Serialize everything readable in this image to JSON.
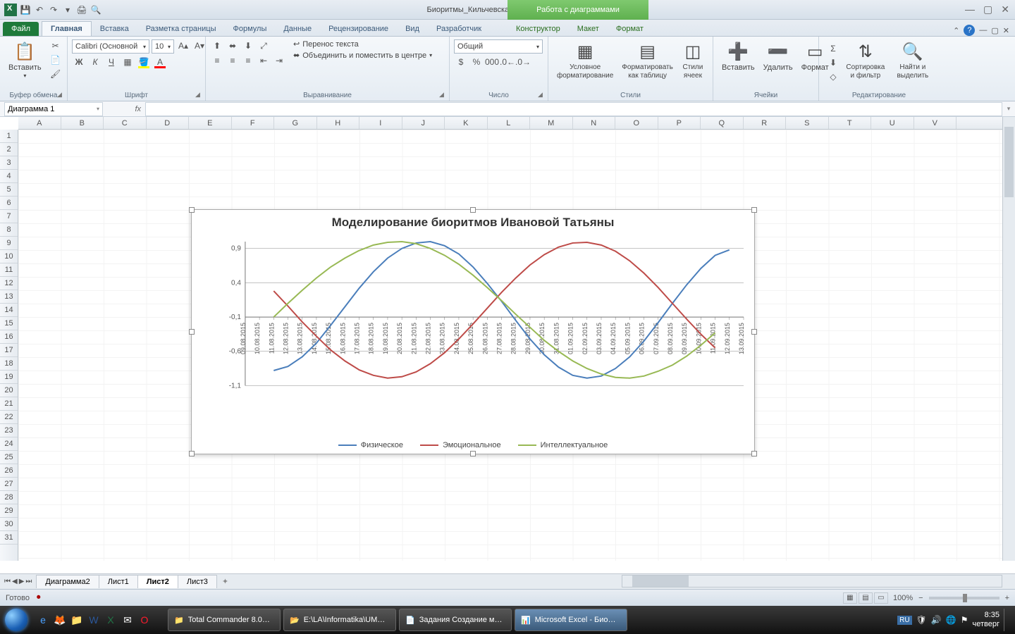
{
  "titlebar": {
    "document": "Биоритмы_Кильчевская.xlsx - Microsoft Excel",
    "chart_tools": "Работа с диаграммами"
  },
  "tabs": {
    "file": "Файл",
    "items": [
      "Главная",
      "Вставка",
      "Разметка страницы",
      "Формулы",
      "Данные",
      "Рецензирование",
      "Вид",
      "Разработчик"
    ],
    "chart_tabs": [
      "Конструктор",
      "Макет",
      "Формат"
    ],
    "active": "Главная"
  },
  "ribbon": {
    "clipboard": {
      "label": "Буфер обмена",
      "paste": "Вставить"
    },
    "font": {
      "label": "Шрифт",
      "name": "Calibri (Основной",
      "size": "10"
    },
    "alignment": {
      "label": "Выравнивание",
      "wrap": "Перенос текста",
      "merge": "Объединить и поместить в центре"
    },
    "number": {
      "label": "Число",
      "format": "Общий"
    },
    "styles": {
      "label": "Стили",
      "cond": "Условное форматирование",
      "table": "Форматировать как таблицу",
      "cell": "Стили ячеек"
    },
    "cells": {
      "label": "Ячейки",
      "insert": "Вставить",
      "delete": "Удалить",
      "format": "Формат"
    },
    "editing": {
      "label": "Редактирование",
      "sort": "Сортировка и фильтр",
      "find": "Найти и выделить"
    }
  },
  "namebox": "Диаграмма 1",
  "columns": [
    "A",
    "B",
    "C",
    "D",
    "E",
    "F",
    "G",
    "H",
    "I",
    "J",
    "K",
    "L",
    "M",
    "N",
    "O",
    "P",
    "Q",
    "R",
    "S",
    "T",
    "U",
    "V"
  ],
  "rows": 31,
  "sheets": {
    "items": [
      "Диаграмма2",
      "Лист1",
      "Лист2",
      "Лист3"
    ],
    "active": "Лист2"
  },
  "status": {
    "ready": "Готово",
    "zoom": "100%",
    "lang": "RU"
  },
  "taskbar": {
    "items": [
      {
        "label": "Total Commander 8.0…",
        "icon": "📁"
      },
      {
        "label": "E:\\LA\\Informatika\\UM…",
        "icon": "📂"
      },
      {
        "label": "Задания Создание м…",
        "icon": "📄"
      },
      {
        "label": "Microsoft Excel - Био…",
        "icon": "📊",
        "active": true
      }
    ],
    "time": "8:35",
    "date": "четверг"
  },
  "chart_data": {
    "type": "line",
    "title": "Моделирование биоритмов Ивановой Татьяны",
    "ylim": [
      -1.1,
      1.0
    ],
    "yticks": [
      -1.1,
      -0.6,
      -0.1,
      0.4,
      0.9
    ],
    "categories": [
      "09.08.2015",
      "10.08.2015",
      "11.08.2015",
      "12.08.2015",
      "13.08.2015",
      "14.08.2015",
      "15.08.2015",
      "16.08.2015",
      "17.08.2015",
      "18.08.2015",
      "19.08.2015",
      "20.08.2015",
      "21.08.2015",
      "22.08.2015",
      "23.08.2015",
      "24.08.2015",
      "25.08.2015",
      "26.08.2015",
      "27.08.2015",
      "28.08.2015",
      "29.08.2015",
      "30.08.2015",
      "31.08.2015",
      "01.09.2015",
      "02.09.2015",
      "03.09.2015",
      "04.09.2015",
      "05.09.2015",
      "06.09.2015",
      "07.09.2015",
      "08.09.2015",
      "09.09.2015",
      "10.09.2015",
      "11.09.2015",
      "12.09.2015",
      "13.09.2015"
    ],
    "series": [
      {
        "name": "Физическое",
        "color": "#4a7ebb",
        "values": [
          null,
          null,
          -0.88,
          -0.82,
          -0.68,
          -0.48,
          -0.22,
          0.05,
          0.32,
          0.56,
          0.76,
          0.9,
          0.98,
          1.0,
          0.94,
          0.82,
          0.63,
          0.39,
          0.13,
          -0.15,
          -0.42,
          -0.65,
          -0.83,
          -0.95,
          -0.99,
          -0.96,
          -0.85,
          -0.68,
          -0.45,
          -0.18,
          0.1,
          0.37,
          0.61,
          0.8,
          0.88,
          null
        ]
      },
      {
        "name": "Эмоциональное",
        "color": "#be4b48",
        "values": [
          null,
          null,
          0.28,
          0.06,
          -0.17,
          -0.38,
          -0.58,
          -0.74,
          -0.87,
          -0.95,
          -0.99,
          -0.97,
          -0.9,
          -0.78,
          -0.62,
          -0.42,
          -0.2,
          0.03,
          0.26,
          0.47,
          0.66,
          0.81,
          0.92,
          0.98,
          0.99,
          0.95,
          0.86,
          0.72,
          0.54,
          0.33,
          0.1,
          -0.13,
          -0.35,
          -0.55,
          null,
          null
        ]
      },
      {
        "name": "Интеллектуальное",
        "color": "#98b954",
        "values": [
          null,
          null,
          -0.1,
          0.1,
          0.29,
          0.47,
          0.63,
          0.76,
          0.87,
          0.95,
          0.99,
          1.0,
          0.97,
          0.9,
          0.8,
          0.67,
          0.51,
          0.33,
          0.14,
          -0.06,
          -0.25,
          -0.44,
          -0.6,
          -0.74,
          -0.85,
          -0.93,
          -0.98,
          -0.99,
          -0.96,
          -0.89,
          -0.8,
          -0.67,
          -0.51,
          -0.33,
          null,
          null
        ]
      }
    ],
    "legend": [
      "Физическое",
      "Эмоциональное",
      "Интеллектуальное"
    ]
  }
}
